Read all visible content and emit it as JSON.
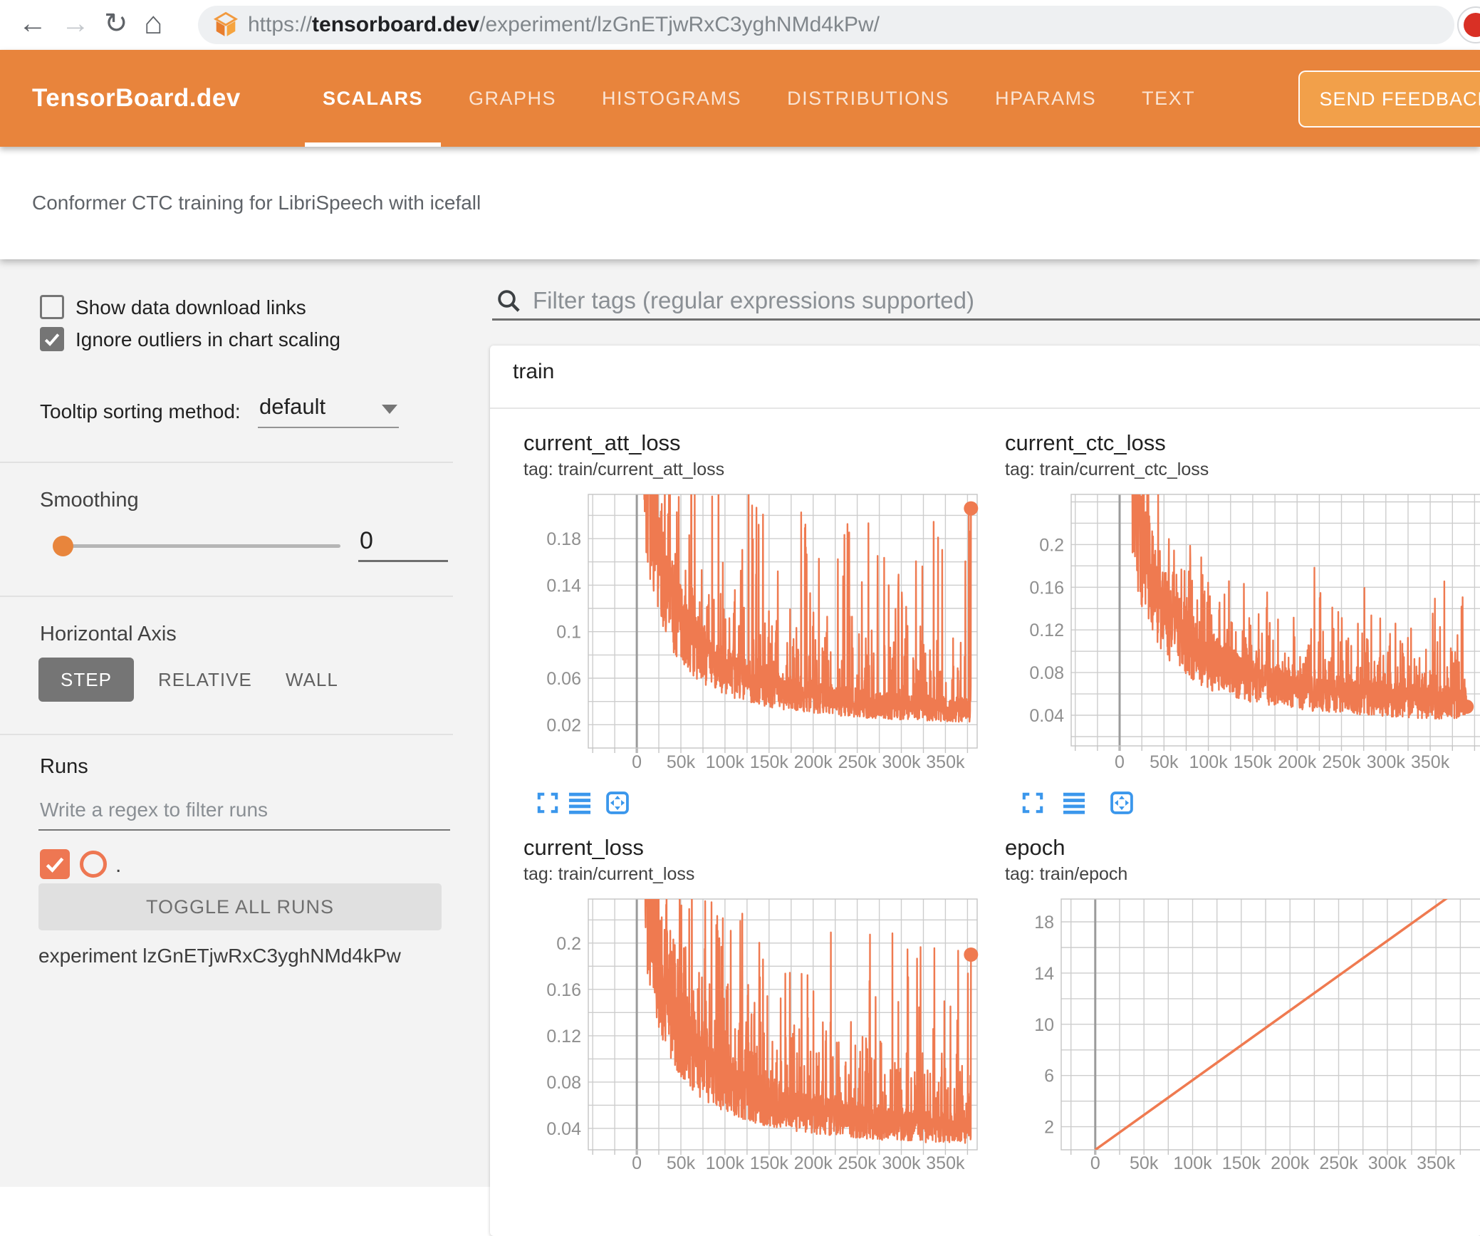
{
  "browser": {
    "icons": {
      "back": "←",
      "forward": "→",
      "refresh": "↻",
      "home": "⌂"
    },
    "url_prefix": "https://",
    "url_domain": "tensorboard.dev",
    "url_path": "/experiment/lzGnETjwRxC3yghNMd4kPw/"
  },
  "header": {
    "brand": "TensorBoard.dev",
    "tabs": [
      {
        "label": "SCALARS",
        "active": true
      },
      {
        "label": "GRAPHS",
        "active": false
      },
      {
        "label": "HISTOGRAMS",
        "active": false
      },
      {
        "label": "DISTRIBUTIONS",
        "active": false
      },
      {
        "label": "HPARAMS",
        "active": false
      },
      {
        "label": "TEXT",
        "active": false
      }
    ],
    "feedback_button": "SEND FEEDBACK"
  },
  "subtitle": "Conformer CTC training for LibriSpeech with icefall",
  "sidebar": {
    "show_download": {
      "label": "Show data download links",
      "checked": false
    },
    "ignore_outliers": {
      "label": "Ignore outliers in chart scaling",
      "checked": true
    },
    "tooltip_sorting": {
      "label": "Tooltip sorting method:",
      "value": "default"
    },
    "smoothing": {
      "label": "Smoothing",
      "value": "0"
    },
    "horizontal_axis": {
      "label": "Horizontal Axis",
      "options": [
        "STEP",
        "RELATIVE",
        "WALL"
      ],
      "selected": "STEP"
    },
    "runs": {
      "label": "Runs",
      "placeholder": "Write a regex to filter runs",
      "run_checkbox_checked": true,
      "run_label": ".",
      "toggle_button": "TOGGLE ALL RUNS",
      "experiment": "experiment lzGnETjwRxC3yghNMd4kPw"
    }
  },
  "main": {
    "filter_placeholder": "Filter tags (regular expressions supported)",
    "section_title": "train",
    "chart_toolbar_icons": [
      "fullscreen-icon",
      "toggle-y-axis-icon",
      "fit-domain-icon"
    ]
  },
  "colors": {
    "header_orange": "#e8843c",
    "feedback_button": "#f2a04a",
    "line_orange": "#ef7a50",
    "run_orange": "#ee7752",
    "icon_blue": "#3b97ec",
    "slider_orange": "#e8853c",
    "grid": "#cdcdcd",
    "zero_line": "#9b9b9b",
    "tick_text": "#8f8f8f"
  },
  "chart_data": [
    {
      "type": "line",
      "style": "noisy-decay",
      "title": "current_att_loss",
      "tag": "tag: train/current_att_loss",
      "xlim": [
        -55000,
        386000
      ],
      "ylim": [
        0,
        0.218
      ],
      "xticks": [
        0,
        50000,
        100000,
        150000,
        200000,
        250000,
        300000,
        350000
      ],
      "xtick_labels": [
        "0",
        "50k",
        "100k",
        "150k",
        "200k",
        "250k",
        "300k",
        "350k"
      ],
      "yticks": [
        0.02,
        0.06,
        0.1,
        0.14,
        0.18
      ],
      "ytick_labels": [
        "0.02",
        "0.06",
        "0.1",
        "0.14",
        "0.18"
      ],
      "xgrid": 25000,
      "ygrid": 0.02,
      "line_color": "#ef7a50",
      "end_marker": true,
      "gen": {
        "seed": 7,
        "n": 1500,
        "x_start": 8000,
        "x_end": 379000,
        "base_start": 0.36,
        "base_end": 0.022,
        "tau": 25000,
        "k": 1.25,
        "noise": 0.32,
        "bump_prob": 0.12,
        "bump_min": 0.015,
        "bump_max": 0.06,
        "spike_prob": 0.045,
        "spike_min": 0.05,
        "spike_max": 0.17,
        "floor": 0.012,
        "final": 0.206
      },
      "trend_points": [
        [
          10000,
          0.22
        ],
        [
          25000,
          0.14
        ],
        [
          50000,
          0.085
        ],
        [
          100000,
          0.06
        ],
        [
          150000,
          0.047
        ],
        [
          200000,
          0.04
        ],
        [
          250000,
          0.036
        ],
        [
          300000,
          0.033
        ],
        [
          350000,
          0.03
        ],
        [
          379000,
          0.206
        ]
      ]
    },
    {
      "type": "line",
      "style": "noisy-decay",
      "title": "current_ctc_loss",
      "tag": "tag: train/current_ctc_loss",
      "xlim": [
        -54600,
        415700
      ],
      "ylim": [
        0.0113,
        0.247
      ],
      "xticks": [
        0,
        50000,
        100000,
        150000,
        200000,
        250000,
        300000,
        350000
      ],
      "xtick_labels": [
        "0",
        "50k",
        "100k",
        "150k",
        "200k",
        "250k",
        "300k",
        "350k"
      ],
      "yticks": [
        0.04,
        0.08,
        0.12,
        0.16,
        0.2
      ],
      "ytick_labels": [
        "0.04",
        "0.08",
        "0.12",
        "0.16",
        "0.2"
      ],
      "xgrid": 25000,
      "ygrid": 0.02,
      "line_color": "#ef7a50",
      "end_marker": true,
      "gen": {
        "seed": 11,
        "n": 1500,
        "x_start": 14000,
        "x_end": 391000,
        "base_start": 0.414,
        "base_end": 0.04,
        "tau": 28000,
        "k": 1.3,
        "noise": 0.3,
        "bump_prob": 0.13,
        "bump_min": 0.01,
        "bump_max": 0.05,
        "spike_prob": 0.04,
        "spike_min": 0.03,
        "spike_max": 0.11,
        "floor": 0.02,
        "final": 0.048
      },
      "trend_points": [
        [
          20000,
          0.25
        ],
        [
          50000,
          0.145
        ],
        [
          100000,
          0.097
        ],
        [
          150000,
          0.08
        ],
        [
          200000,
          0.07
        ],
        [
          250000,
          0.063
        ],
        [
          300000,
          0.058
        ],
        [
          350000,
          0.053
        ],
        [
          391000,
          0.048
        ]
      ]
    },
    {
      "type": "line",
      "style": "noisy-decay",
      "title": "current_loss",
      "tag": "tag: train/current_loss",
      "xlim": [
        -55000,
        386000
      ],
      "ylim": [
        0.0215,
        0.238
      ],
      "xticks": [
        0,
        50000,
        100000,
        150000,
        200000,
        250000,
        300000,
        350000
      ],
      "xtick_labels": [
        "0",
        "50k",
        "100k",
        "150k",
        "200k",
        "250k",
        "300k",
        "350k"
      ],
      "yticks": [
        0.04,
        0.08,
        0.12,
        0.16,
        0.2
      ],
      "ytick_labels": [
        "0.04",
        "0.08",
        "0.12",
        "0.16",
        "0.2"
      ],
      "xgrid": 25000,
      "ygrid": 0.02,
      "line_color": "#ef7a50",
      "end_marker": true,
      "gen": {
        "seed": 23,
        "n": 1500,
        "x_start": 8000,
        "x_end": 379000,
        "base_start": 0.4,
        "base_end": 0.026,
        "tau": 25000,
        "k": 1.2,
        "noise": 0.33,
        "bump_prob": 0.12,
        "bump_min": 0.015,
        "bump_max": 0.06,
        "spike_prob": 0.045,
        "spike_min": 0.05,
        "spike_max": 0.16,
        "floor": 0.025,
        "final": 0.19
      },
      "trend_points": [
        [
          10000,
          0.23
        ],
        [
          25000,
          0.15
        ],
        [
          50000,
          0.09
        ],
        [
          100000,
          0.065
        ],
        [
          150000,
          0.05
        ],
        [
          200000,
          0.045
        ],
        [
          250000,
          0.04
        ],
        [
          300000,
          0.037
        ],
        [
          350000,
          0.034
        ],
        [
          379000,
          0.19
        ]
      ]
    },
    {
      "type": "line",
      "style": "linear",
      "title": "epoch",
      "tag": "tag: train/epoch",
      "xlim": [
        -35000,
        404000
      ],
      "ylim": [
        0.2,
        19.78
      ],
      "xticks": [
        0,
        50000,
        100000,
        150000,
        200000,
        250000,
        300000,
        350000
      ],
      "xtick_labels": [
        "0",
        "50k",
        "100k",
        "150k",
        "200k",
        "250k",
        "300k",
        "350k"
      ],
      "yticks": [
        2,
        6,
        10,
        14,
        18
      ],
      "ytick_labels": [
        "2",
        "6",
        "10",
        "14",
        "18"
      ],
      "xgrid": 25000,
      "ygrid": 2,
      "line_color": "#ef7a50",
      "end_marker": false,
      "points": [
        [
          0,
          0.2
        ],
        [
          375000,
          20.6
        ]
      ],
      "trend_points": [
        [
          0,
          0
        ],
        [
          100000,
          5.4
        ],
        [
          200000,
          10.9
        ],
        [
          300000,
          16.3
        ],
        [
          367000,
          20
        ]
      ]
    }
  ]
}
